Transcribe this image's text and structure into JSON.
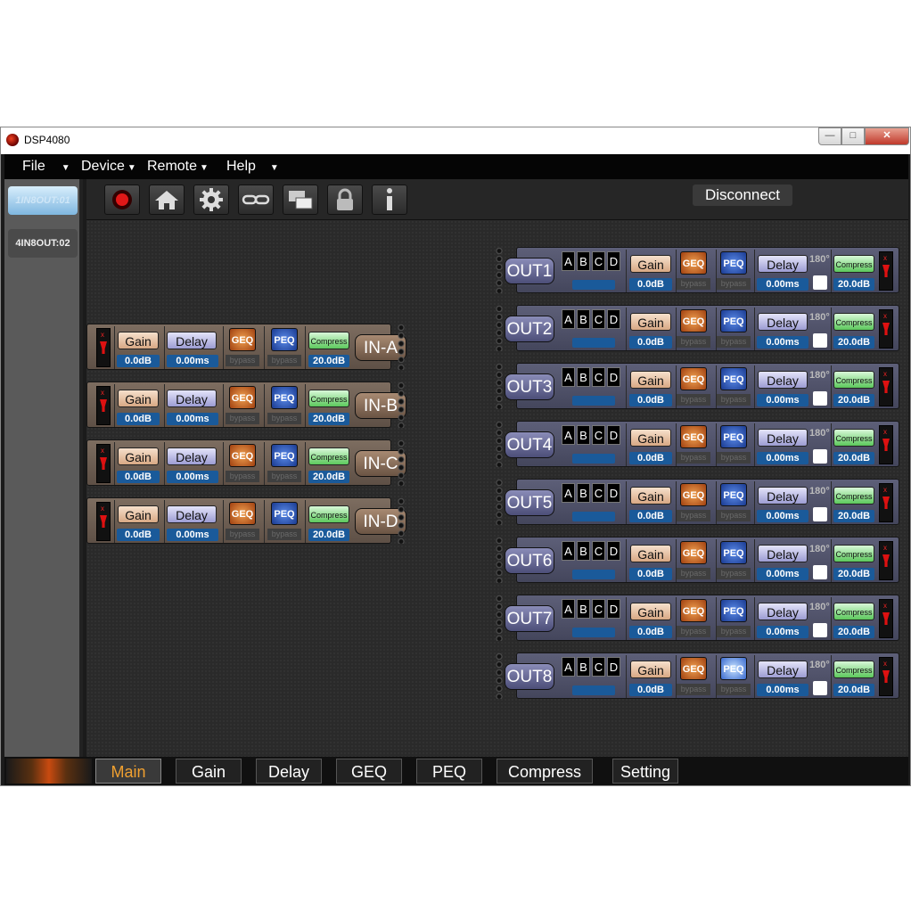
{
  "window": {
    "title": "DSP4080",
    "min": "—",
    "max": "□",
    "close": "✕"
  },
  "menu": [
    {
      "label": "File"
    },
    {
      "label": "Device"
    },
    {
      "label": "Remote"
    },
    {
      "label": "Help"
    }
  ],
  "sidebar": {
    "devices": [
      "1IN8OUT:01",
      "4IN8OUT:02"
    ]
  },
  "toolbar": {
    "icons": [
      "record-icon",
      "home-icon",
      "gear-icon",
      "link-icon",
      "windows-icon",
      "lock-icon",
      "info-icon"
    ],
    "disconnect_label": "Disconnect"
  },
  "labels": {
    "gain": "Gain",
    "delay": "Delay",
    "geq": "GEQ",
    "peq": "PEQ",
    "compress": "Compress",
    "bypass": "bypass",
    "phase": "180°",
    "meter_x": "x",
    "a": "A",
    "b": "B",
    "c": "C",
    "d": "D"
  },
  "inputs": [
    {
      "name": "IN-A",
      "gain": "0.0dB",
      "delay": "0.00ms",
      "compress": "20.0dB"
    },
    {
      "name": "IN-B",
      "gain": "0.0dB",
      "delay": "0.00ms",
      "compress": "20.0dB"
    },
    {
      "name": "IN-C",
      "gain": "0.0dB",
      "delay": "0.00ms",
      "compress": "20.0dB"
    },
    {
      "name": "IN-D",
      "gain": "0.0dB",
      "delay": "0.00ms",
      "compress": "20.0dB"
    }
  ],
  "outputs": [
    {
      "name": "OUT1",
      "gain": "0.0dB",
      "delay": "0.00ms",
      "compress": "20.0dB"
    },
    {
      "name": "OUT2",
      "gain": "0.0dB",
      "delay": "0.00ms",
      "compress": "20.0dB"
    },
    {
      "name": "OUT3",
      "gain": "0.0dB",
      "delay": "0.00ms",
      "compress": "20.0dB"
    },
    {
      "name": "OUT4",
      "gain": "0.0dB",
      "delay": "0.00ms",
      "compress": "20.0dB"
    },
    {
      "name": "OUT5",
      "gain": "0.0dB",
      "delay": "0.00ms",
      "compress": "20.0dB"
    },
    {
      "name": "OUT6",
      "gain": "0.0dB",
      "delay": "0.00ms",
      "compress": "20.0dB"
    },
    {
      "name": "OUT7",
      "gain": "0.0dB",
      "delay": "0.00ms",
      "compress": "20.0dB"
    },
    {
      "name": "OUT8",
      "gain": "0.0dB",
      "delay": "0.00ms",
      "compress": "20.0dB"
    }
  ],
  "tabs": [
    "Main",
    "Gain",
    "Delay",
    "GEQ",
    "PEQ",
    "Compress",
    "Setting"
  ],
  "active_tab": "Main",
  "colors": {
    "accent": "#f0a030",
    "value_bg": "#1a5a9a",
    "clip_led": "#dd1111"
  }
}
